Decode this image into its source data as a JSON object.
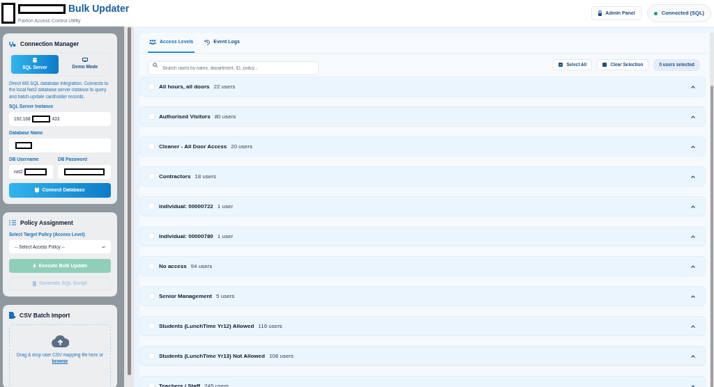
{
  "header": {
    "title": "Bulk Updater",
    "subtitle": "Paxton Access Control Utility",
    "admin_button": "Admin Panel",
    "status": {
      "label": "Connected (SQL)",
      "color": "#22a06b"
    }
  },
  "connection_manager": {
    "title": "Connection Manager",
    "modes": [
      {
        "label": "SQL Server",
        "selected": true
      },
      {
        "label": "Demo Mode",
        "selected": false
      }
    ],
    "description": "Direct MS SQL database integration. Connects to the local Net2 database server instance to query and batch-update cardholder records.",
    "fields": [
      {
        "label": "SQL Server Instance",
        "value_start": "192.168",
        "value_end": "433"
      },
      {
        "label": "Database Name"
      },
      {
        "label": "DB Username",
        "value_start": "net2"
      },
      {
        "label": "DB Password"
      }
    ],
    "connect_button": "Connect Database"
  },
  "policy_assignment": {
    "title": "Policy Assignment",
    "select_label": "Select Target Policy (Access Level)",
    "select_value": "-- Select Access Policy --",
    "execute_button": {
      "label": "Execute Bulk Update",
      "disabled": true
    },
    "generate_button": {
      "label": "Generate SQL Script",
      "disabled": true
    }
  },
  "csv_import": {
    "title": "CSV Batch Import",
    "drop_text": "Drag & drop user CSV mapping file here or",
    "browse_link": "browse"
  },
  "tabs": [
    {
      "label": "Access Levels",
      "selected": true
    },
    {
      "label": "Event Logs",
      "selected": false
    }
  ],
  "search": {
    "placeholder": "Search users by name, department, ID, policy..."
  },
  "select_all": "Select All",
  "clear_selection": "Clear Selection",
  "selected_count": "0 users selected",
  "groups": [
    {
      "name": "All hours, all doors",
      "count": "22 users",
      "checked": false
    },
    {
      "name": "Authorised Visitors",
      "count": "80 users",
      "checked": false
    },
    {
      "name": "Cleaner - All Door Access",
      "count": "20 users",
      "checked": false
    },
    {
      "name": "Contractors",
      "count": "18 users",
      "checked": false
    },
    {
      "name": "Individual: 00000722",
      "count": "1 user",
      "checked": false
    },
    {
      "name": "Individual: 00000780",
      "count": "1 user",
      "checked": false
    },
    {
      "name": "No access",
      "count": "94 users",
      "checked": false
    },
    {
      "name": "Senior Management",
      "count": "5 users",
      "checked": false
    },
    {
      "name": "Students (LunchTime Yr12) Allowed",
      "count": "116 users",
      "checked": false
    },
    {
      "name": "Students (LunchTime Yr13) Not Allowed",
      "count": "108 users",
      "checked": false
    },
    {
      "name": "Teachers / Staff",
      "count": "245 users",
      "checked": false
    }
  ]
}
